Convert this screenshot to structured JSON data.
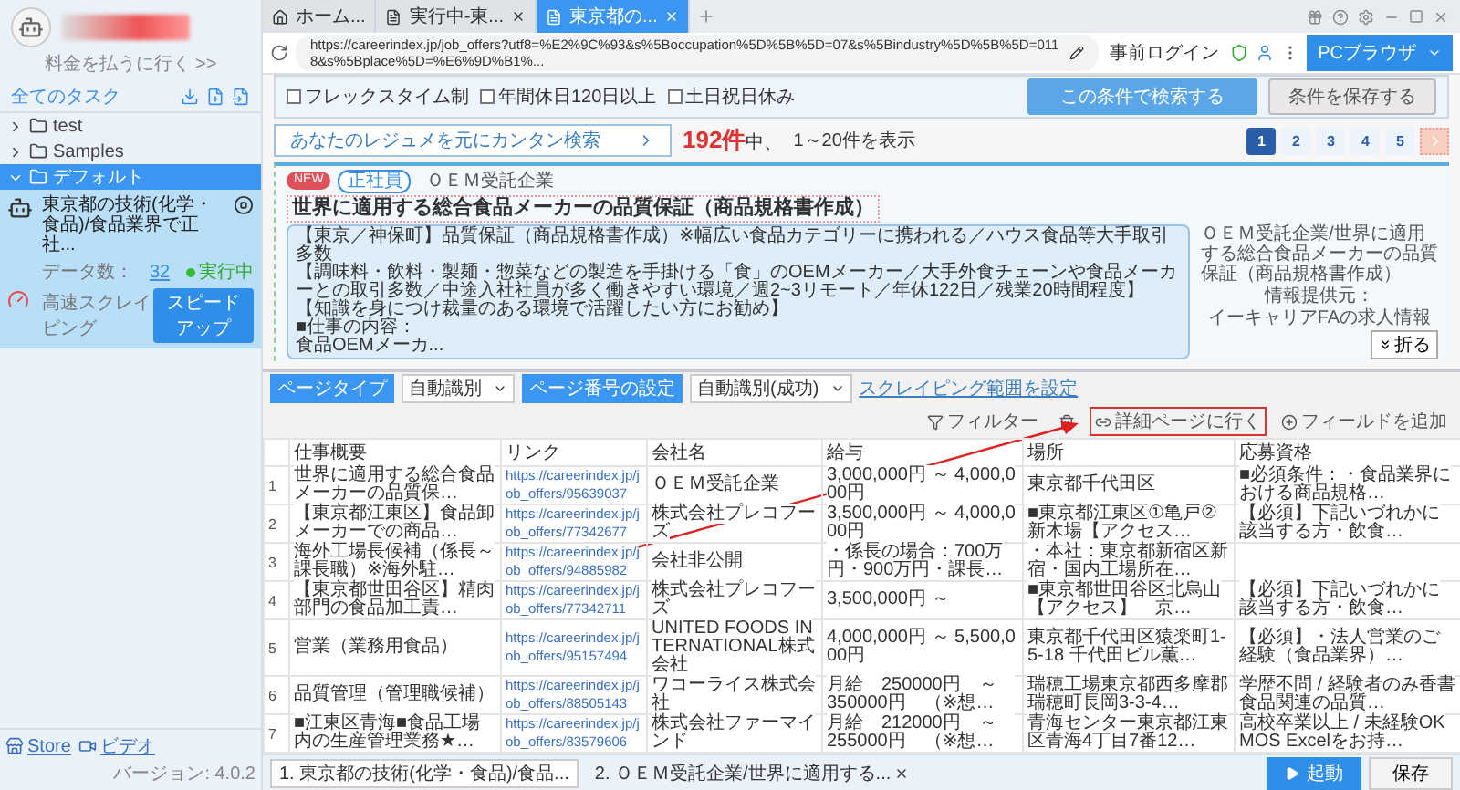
{
  "sidebar": {
    "pay_link": "料金を払うに行く >>",
    "all_tasks": "全てのタスク",
    "tree": [
      {
        "label": "test",
        "expanded": false,
        "selected": false
      },
      {
        "label": "Samples",
        "expanded": false,
        "selected": false
      },
      {
        "label": "デフォルト",
        "expanded": true,
        "selected": true,
        "tasks": [
          {
            "title": "東京都の技術(化学・食品)/食品業界で正社...",
            "data_label": "データ数：",
            "data_count": "32",
            "status": "実行中",
            "mode": "高速スクレイピング",
            "action": "スピードアップ"
          }
        ]
      }
    ],
    "footer": {
      "links": [
        {
          "kind": "store",
          "label": "Store"
        },
        {
          "kind": "video",
          "label": "ビデオ"
        }
      ],
      "version": "バージョン: 4.0.2"
    }
  },
  "browser": {
    "tabs": [
      {
        "kind": "home",
        "label": "ホーム...",
        "selected": false
      },
      {
        "kind": "page",
        "label": "実行中-東...",
        "selected": false
      },
      {
        "kind": "page",
        "label": "東京都の...",
        "selected": true
      }
    ],
    "url": "https://careerindex.jp/job_offers?utf8=%E2%9C%93&s%5Boccupation%5D%5B%5D=07&s%5Bindustry%5D%5B%5D=0118&s%5Bplace%5D=%E6%9D%B1%...",
    "pre_login": "事前ログイン",
    "mode_button": "PCブラウザ"
  },
  "page": {
    "filters": [
      {
        "label": "フレックスタイム制",
        "checked": false
      },
      {
        "label": "年間休日120日以上",
        "checked": false
      },
      {
        "label": "土日祝日休み",
        "checked": false
      }
    ],
    "search_button": "この条件で検索する",
    "save_button": "条件を保存する",
    "resume_search": "あなたのレジュメを元にカンタン検索",
    "count": "192件",
    "count_suffix": "中、",
    "range": "1～20件を表示",
    "pages": [
      {
        "label": "1",
        "selected": true
      },
      {
        "label": "2",
        "selected": false
      },
      {
        "label": "3",
        "selected": false
      },
      {
        "label": "4",
        "selected": false
      },
      {
        "label": "5",
        "selected": false
      }
    ],
    "job": {
      "badges": [
        {
          "kind": "new",
          "label": "NEW"
        },
        {
          "kind": "type",
          "label": "正社員"
        }
      ],
      "company": "ＯＥＭ受託企業",
      "title": "世界に適用する総合食品メーカーの品質保証（商品規格書作成）",
      "description": [
        "【東京／神保町】品質保証（商品規格書作成）※幅広い食品カテゴリーに携われる／ハウス食品等大手取引多数",
        "【調味料・飲料・製麺・惣菜などの製造を手掛ける「食」のOEMメーカー／大手外食チェーンや食品メーカーとの取引多数／中途入社社員が多く働きやすい環境／週2~3リモート／年休122日／残業20時間程度】",
        "【知識を身につけ裁量のある環境で活躍したい方にお勧め】",
        "■仕事の内容：",
        "食品OEMメーカ..."
      ],
      "image_alt": "ＯＥＭ受託企業/世界に適用する総合食品メーカーの品質保証（商品規格書作成）",
      "source_label": "情報提供元：",
      "source": "イーキャリアFAの求人情報"
    },
    "collapse": "折る"
  },
  "panel": {
    "page_type": {
      "label": "ページタイプ",
      "value": "自動識別"
    },
    "page_number": {
      "label": "ページ番号の設定",
      "value": "自動識別(成功)"
    },
    "range_link": "スクレイピング範囲を設定",
    "tools": [
      {
        "kind": "filter",
        "label": "フィルター",
        "highlighted": false
      },
      {
        "kind": "delete",
        "highlighted": false
      },
      {
        "kind": "detail",
        "label": "詳細ページに行く",
        "highlighted": true
      },
      {
        "kind": "add",
        "label": "フィールドを追加",
        "highlighted": false
      }
    ],
    "columns": [
      "仕事概要",
      "リンク",
      "会社名",
      "給与",
      "場所",
      "応募資格"
    ],
    "rows": [
      {
        "index": "1",
        "cells": [
          "世界に適用する総合食品メーカーの品質保…",
          "https://careerindex.jp/job_offers/95639037",
          "ＯＥＭ受託企業",
          "3,000,000円 ～ 4,000,000円",
          "東京都千代田区",
          "■必須条件：・食品業界における商品規格…"
        ]
      },
      {
        "index": "2",
        "cells": [
          "【東京都江東区】食品卸メーカーでの商品…",
          "https://careerindex.jp/job_offers/77342677",
          "株式会社プレコフーズ",
          "3,500,000円 ～ 4,000,000円",
          "■東京都江東区①亀戸②新木場【アクセス…",
          "【必須】下記いづれかに該当する方・飲食…"
        ]
      },
      {
        "index": "3",
        "cells": [
          "海外工場長候補（係長～課長職）※海外駐…",
          "https://careerindex.jp/job_offers/94885982",
          "会社非公開",
          "・係長の場合：700万円・900万円・課長…",
          "・本社：東京都新宿区新宿・国内工場所在…",
          null
        ]
      },
      {
        "index": "4",
        "cells": [
          "【東京都世田谷区】精肉部門の食品加工責…",
          "https://careerindex.jp/job_offers/77342711",
          "株式会社プレコフーズ",
          "3,500,000円 ～",
          "■東京都世田谷区北烏山【アクセス】　京…",
          "【必須】下記いづれかに該当する方・飲食…"
        ]
      },
      {
        "index": "5",
        "cells": [
          "営業（業務用食品）",
          "https://careerindex.jp/job_offers/95157494",
          "UNITED FOODS INTERNATIONAL株式会社",
          "4,000,000円 ～ 5,500,000円",
          "東京都千代田区猿楽町1-5-18 千代田ビル薫…",
          "【必須】・法人営業のご経験（食品業界）…"
        ]
      },
      {
        "index": "6",
        "cells": [
          "品質管理（管理職候補）",
          "https://careerindex.jp/job_offers/88505143",
          "ワコーライス株式会社",
          "月給　250000円　～　350000円　（※想…",
          "瑞穂工場東京都西多摩郡瑞穂町長岡3-3-4…",
          "学歴不問 / 経験者のみ香書食品関連の品質…"
        ]
      },
      {
        "index": "7",
        "cells": [
          "■江東区青海■食品工場内の生産管理業務★…",
          "https://careerindex.jp/job_offers/83579606",
          "株式会社ファーマインド",
          "月給　212000円　～　255000円　（※想…",
          "青海センター東京都江東区青海4丁目7番12…",
          "高校卒業以上 / 未経験OKMOS Excelをお持…"
        ]
      }
    ]
  },
  "task_tabs": [
    {
      "label": "1. 東京都の技術(化学・食品)/食品...",
      "selected": true
    },
    {
      "label": "2. ＯＥＭ受託企業/世界に適用する...",
      "selected": false
    }
  ],
  "actions": {
    "start": "起動",
    "save": "保存"
  }
}
